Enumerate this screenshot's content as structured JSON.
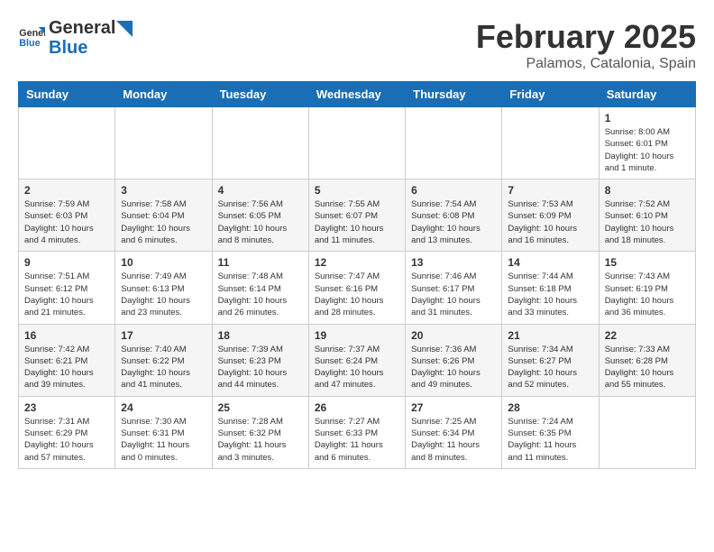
{
  "header": {
    "logo_text_general": "General",
    "logo_text_blue": "Blue",
    "month_title": "February 2025",
    "location": "Palamos, Catalonia, Spain"
  },
  "weekdays": [
    "Sunday",
    "Monday",
    "Tuesday",
    "Wednesday",
    "Thursday",
    "Friday",
    "Saturday"
  ],
  "weeks": [
    [
      {
        "day": "",
        "info": ""
      },
      {
        "day": "",
        "info": ""
      },
      {
        "day": "",
        "info": ""
      },
      {
        "day": "",
        "info": ""
      },
      {
        "day": "",
        "info": ""
      },
      {
        "day": "",
        "info": ""
      },
      {
        "day": "1",
        "info": "Sunrise: 8:00 AM\nSunset: 6:01 PM\nDaylight: 10 hours and 1 minute."
      }
    ],
    [
      {
        "day": "2",
        "info": "Sunrise: 7:59 AM\nSunset: 6:03 PM\nDaylight: 10 hours and 4 minutes."
      },
      {
        "day": "3",
        "info": "Sunrise: 7:58 AM\nSunset: 6:04 PM\nDaylight: 10 hours and 6 minutes."
      },
      {
        "day": "4",
        "info": "Sunrise: 7:56 AM\nSunset: 6:05 PM\nDaylight: 10 hours and 8 minutes."
      },
      {
        "day": "5",
        "info": "Sunrise: 7:55 AM\nSunset: 6:07 PM\nDaylight: 10 hours and 11 minutes."
      },
      {
        "day": "6",
        "info": "Sunrise: 7:54 AM\nSunset: 6:08 PM\nDaylight: 10 hours and 13 minutes."
      },
      {
        "day": "7",
        "info": "Sunrise: 7:53 AM\nSunset: 6:09 PM\nDaylight: 10 hours and 16 minutes."
      },
      {
        "day": "8",
        "info": "Sunrise: 7:52 AM\nSunset: 6:10 PM\nDaylight: 10 hours and 18 minutes."
      }
    ],
    [
      {
        "day": "9",
        "info": "Sunrise: 7:51 AM\nSunset: 6:12 PM\nDaylight: 10 hours and 21 minutes."
      },
      {
        "day": "10",
        "info": "Sunrise: 7:49 AM\nSunset: 6:13 PM\nDaylight: 10 hours and 23 minutes."
      },
      {
        "day": "11",
        "info": "Sunrise: 7:48 AM\nSunset: 6:14 PM\nDaylight: 10 hours and 26 minutes."
      },
      {
        "day": "12",
        "info": "Sunrise: 7:47 AM\nSunset: 6:16 PM\nDaylight: 10 hours and 28 minutes."
      },
      {
        "day": "13",
        "info": "Sunrise: 7:46 AM\nSunset: 6:17 PM\nDaylight: 10 hours and 31 minutes."
      },
      {
        "day": "14",
        "info": "Sunrise: 7:44 AM\nSunset: 6:18 PM\nDaylight: 10 hours and 33 minutes."
      },
      {
        "day": "15",
        "info": "Sunrise: 7:43 AM\nSunset: 6:19 PM\nDaylight: 10 hours and 36 minutes."
      }
    ],
    [
      {
        "day": "16",
        "info": "Sunrise: 7:42 AM\nSunset: 6:21 PM\nDaylight: 10 hours and 39 minutes."
      },
      {
        "day": "17",
        "info": "Sunrise: 7:40 AM\nSunset: 6:22 PM\nDaylight: 10 hours and 41 minutes."
      },
      {
        "day": "18",
        "info": "Sunrise: 7:39 AM\nSunset: 6:23 PM\nDaylight: 10 hours and 44 minutes."
      },
      {
        "day": "19",
        "info": "Sunrise: 7:37 AM\nSunset: 6:24 PM\nDaylight: 10 hours and 47 minutes."
      },
      {
        "day": "20",
        "info": "Sunrise: 7:36 AM\nSunset: 6:26 PM\nDaylight: 10 hours and 49 minutes."
      },
      {
        "day": "21",
        "info": "Sunrise: 7:34 AM\nSunset: 6:27 PM\nDaylight: 10 hours and 52 minutes."
      },
      {
        "day": "22",
        "info": "Sunrise: 7:33 AM\nSunset: 6:28 PM\nDaylight: 10 hours and 55 minutes."
      }
    ],
    [
      {
        "day": "23",
        "info": "Sunrise: 7:31 AM\nSunset: 6:29 PM\nDaylight: 10 hours and 57 minutes."
      },
      {
        "day": "24",
        "info": "Sunrise: 7:30 AM\nSunset: 6:31 PM\nDaylight: 11 hours and 0 minutes."
      },
      {
        "day": "25",
        "info": "Sunrise: 7:28 AM\nSunset: 6:32 PM\nDaylight: 11 hours and 3 minutes."
      },
      {
        "day": "26",
        "info": "Sunrise: 7:27 AM\nSunset: 6:33 PM\nDaylight: 11 hours and 6 minutes."
      },
      {
        "day": "27",
        "info": "Sunrise: 7:25 AM\nSunset: 6:34 PM\nDaylight: 11 hours and 8 minutes."
      },
      {
        "day": "28",
        "info": "Sunrise: 7:24 AM\nSunset: 6:35 PM\nDaylight: 11 hours and 11 minutes."
      },
      {
        "day": "",
        "info": ""
      }
    ]
  ]
}
